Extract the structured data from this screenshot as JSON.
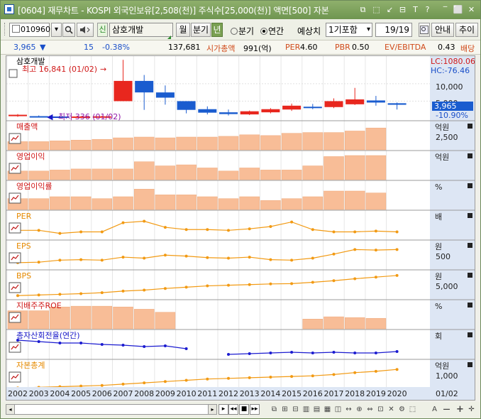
{
  "window": {
    "title": "[0604] 재무차트 - KOSPI 외국인보유[2,508(천)] 주식수[25,000(천)] 액면[500] 자본",
    "buttons": [
      "⧉",
      "⬚",
      "↙",
      "⊟",
      "T",
      "?",
      "‾",
      "⬜",
      "✕"
    ]
  },
  "toolbar": {
    "code": "010960",
    "search_icon": "magnifier-icon",
    "sound_icon": "speaker-icon",
    "credit_badge": "신",
    "name": "삼호개발",
    "period_month": "월",
    "period_quarter": "분기",
    "period_year": "년",
    "radio_quarter": "분기",
    "radio_annual": "연간",
    "forecast_label": "예상치",
    "forecast_value": "1기포함",
    "page": "19/19",
    "guide_label": "안내",
    "add_label": "추이"
  },
  "info": {
    "price": "3,965",
    "change_arrow": "▼",
    "change": "15",
    "change_pct": "-0.38%",
    "volume": "137,681",
    "mktcap_label": "시가총액",
    "mktcap_value": "991(억)",
    "per_label": "PER",
    "per_value": "4.60",
    "pbr_label": "PBR",
    "pbr_value": "0.50",
    "ev_label": "EV/EBITDA",
    "ev_value": "0.43",
    "div_label": "배당"
  },
  "chart_data": {
    "type": "financial-multi-panel",
    "x_years": [
      "2002",
      "2003",
      "2004",
      "2005",
      "2006",
      "2007",
      "2008",
      "2009",
      "2010",
      "2011",
      "2012",
      "2013",
      "2014",
      "2015",
      "2016",
      "2017",
      "2018",
      "2019",
      "2020"
    ],
    "x_extra": "01/02",
    "price": {
      "title": "삼호개발",
      "high_note": "최고 16,841 (01/02)",
      "low_note": "최저 336 (01/02)",
      "lc": "LC:1080.06",
      "hc": "HC:-76.46",
      "axis_labels": [
        "10,000",
        "5,000"
      ],
      "current": "3,965",
      "current_pct": "-10.90%",
      "ylim": [
        0,
        17500
      ],
      "candles": [
        {
          "o": 800,
          "c": 1100,
          "h": 1300,
          "l": 500
        },
        {
          "o": 700,
          "c": 500,
          "h": 900,
          "l": 400
        },
        {
          "o": 600,
          "c": 500,
          "h": 800,
          "l": 336
        },
        {
          "o": 600,
          "c": 600,
          "h": 700,
          "l": 500
        },
        {
          "o": 600,
          "c": 650,
          "h": 800,
          "l": 500
        },
        {
          "o": 5000,
          "c": 10800,
          "h": 16841,
          "l": 5000
        },
        {
          "o": 10800,
          "c": 7500,
          "h": 12500,
          "l": 2500
        },
        {
          "o": 7500,
          "c": 6000,
          "h": 9500,
          "l": 4000
        },
        {
          "o": 5000,
          "c": 2500,
          "h": 5000,
          "l": 1500
        },
        {
          "o": 2700,
          "c": 1700,
          "h": 3500,
          "l": 1200
        },
        {
          "o": 1800,
          "c": 1300,
          "h": 2600,
          "l": 900
        },
        {
          "o": 1200,
          "c": 2100,
          "h": 2300,
          "l": 1000
        },
        {
          "o": 1800,
          "c": 2700,
          "h": 3000,
          "l": 1500
        },
        {
          "o": 2600,
          "c": 3700,
          "h": 4300,
          "l": 2200
        },
        {
          "o": 3400,
          "c": 3300,
          "h": 4200,
          "l": 2700
        },
        {
          "o": 3300,
          "c": 5000,
          "h": 5800,
          "l": 3000
        },
        {
          "o": 4100,
          "c": 5500,
          "h": 8800,
          "l": 3900
        },
        {
          "o": 5200,
          "c": 4600,
          "h": 6500,
          "l": 3700
        },
        {
          "o": 4400,
          "c": 3965,
          "h": 4600,
          "l": 2600
        }
      ],
      "up_color": "#e8271e",
      "down_color": "#1a5ccf"
    },
    "panels": [
      {
        "title": "매출액",
        "unit": "억원",
        "axis": "2,500",
        "kind": "bar",
        "ylim": [
          0,
          3000
        ],
        "values": [
          900,
          900,
          1000,
          1100,
          1200,
          1400,
          1500,
          1400,
          1500,
          1500,
          1600,
          1800,
          1700,
          2000,
          2100,
          2100,
          2300,
          2700,
          null
        ]
      },
      {
        "title": "영업이익",
        "unit": "억원",
        "axis": "",
        "kind": "bar",
        "ylim": [
          0,
          220
        ],
        "values": [
          70,
          70,
          80,
          90,
          90,
          90,
          160,
          120,
          130,
          100,
          70,
          100,
          80,
          80,
          120,
          210,
          220,
          220,
          null
        ]
      },
      {
        "title": "영업이익률",
        "unit": "%",
        "axis": "",
        "kind": "bar",
        "ylim": [
          0,
          12
        ],
        "values": [
          5,
          5,
          6,
          6,
          5,
          6,
          10,
          7,
          7,
          6,
          5,
          6,
          4,
          5,
          6,
          9,
          9,
          8,
          null
        ]
      },
      {
        "title": "PER",
        "unit": "배",
        "axis": "",
        "kind": "line",
        "color": "#f29a13",
        "ylim": [
          0,
          30
        ],
        "values": [
          10,
          10,
          6,
          8,
          8,
          20,
          22,
          14,
          11,
          11,
          10,
          12,
          15,
          21,
          11,
          8,
          8,
          9,
          8
        ]
      },
      {
        "title": "EPS",
        "unit": "원",
        "axis": "500",
        "kind": "line",
        "color": "#f29a13",
        "ylim": [
          0,
          900
        ],
        "values": [
          200,
          220,
          300,
          320,
          300,
          420,
          380,
          500,
          460,
          400,
          380,
          420,
          320,
          300,
          380,
          540,
          720,
          700,
          720
        ]
      },
      {
        "title": "BPS",
        "unit": "원",
        "axis": "5,000",
        "kind": "line",
        "color": "#f29a13",
        "ylim": [
          0,
          7000
        ],
        "values": [
          600,
          800,
          1000,
          1200,
          1500,
          2000,
          2300,
          2800,
          3200,
          3600,
          3800,
          4000,
          4200,
          4300,
          4700,
          5200,
          5800,
          6300,
          6800
        ]
      },
      {
        "title": "지배주주ROE",
        "unit": "%",
        "axis": "",
        "kind": "bar",
        "ylim": [
          0,
          30
        ],
        "values": [
          22,
          22,
          27,
          28,
          28,
          27,
          24,
          20,
          0,
          0,
          0,
          0,
          0,
          0,
          11,
          14,
          13,
          12,
          null
        ]
      },
      {
        "title": "총자산회전율(연간)",
        "unit": "회",
        "axis": "",
        "kind": "line",
        "color": "#1b1bd0",
        "ylim": [
          0,
          1.6
        ],
        "values": [
          1.2,
          1.1,
          1.0,
          1.0,
          0.9,
          0.85,
          0.75,
          0.8,
          0.6,
          null,
          0.2,
          0.25,
          0.3,
          0.35,
          0.3,
          0.35,
          0.3,
          0.3,
          0.4
        ]
      },
      {
        "title": "자본총계",
        "unit": "억원",
        "axis": "1,000",
        "kind": "line",
        "color": "#f29a13",
        "ylim": [
          0,
          2000
        ],
        "values": [
          150,
          200,
          250,
          300,
          350,
          450,
          550,
          650,
          750,
          850,
          900,
          950,
          1000,
          1050,
          1100,
          1200,
          1350,
          1450,
          1600
        ]
      }
    ]
  },
  "footer": {
    "nav_icons": [
      "▸",
      "◂◂",
      "■",
      "▸▸"
    ],
    "tool_icons": [
      "⧉",
      "⊞",
      "⊟",
      "▥",
      "▤",
      "▦",
      "◫",
      "↔",
      "⊕",
      "⇔",
      "⊡",
      "✕",
      "⚙",
      "⬚"
    ],
    "zoom_out": "—",
    "zoom_in": "+",
    "print_icon": "A"
  }
}
